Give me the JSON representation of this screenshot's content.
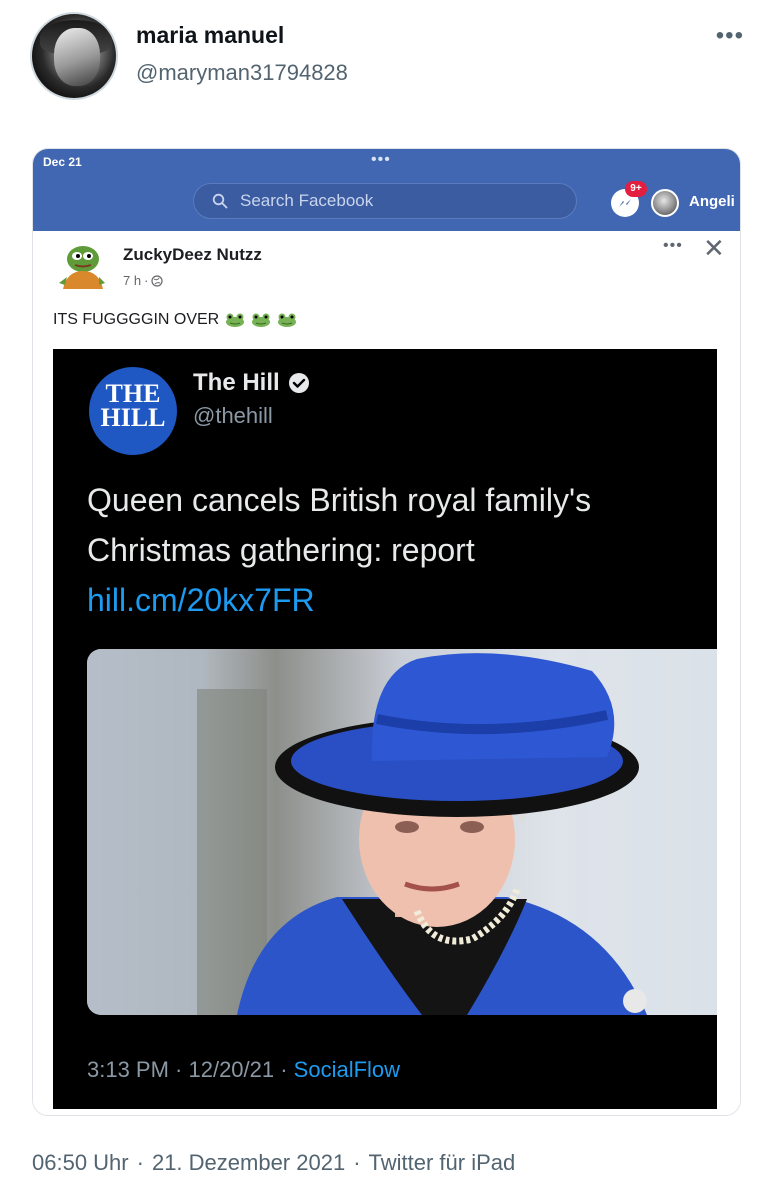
{
  "tweet": {
    "display_name": "maria manuel",
    "handle": "@maryman31794828",
    "more_label": "•••",
    "footer": {
      "time": "06:50 Uhr",
      "sep1": "·",
      "date": "21. Dezember 2021",
      "sep2": "·",
      "client": "Twitter für iPad"
    }
  },
  "facebook": {
    "date_label": "Dec 21",
    "top_dots": "•••",
    "search_placeholder": "Search Facebook",
    "notification_badge": "9+",
    "profile_name": "Angeli",
    "accent_color": "#4267b2"
  },
  "post": {
    "author": "ZuckyDeez Nutzz",
    "time": "7 h",
    "dot": "·",
    "more_label": "•••",
    "close_label": "✕",
    "text": "ITS FUGGGGIN OVER"
  },
  "hill_tweet": {
    "logo_line1": "THE",
    "logo_line2": "HILL",
    "name": "The Hill",
    "handle": "@thehill",
    "text": "Queen cancels British royal family's Christmas gathering: report ",
    "link": "hill.cm/20kx7FR",
    "footer_time": "3:13 PM · 12/20/21 · ",
    "footer_source": "SocialFlow",
    "link_color": "#1d9bf0"
  }
}
